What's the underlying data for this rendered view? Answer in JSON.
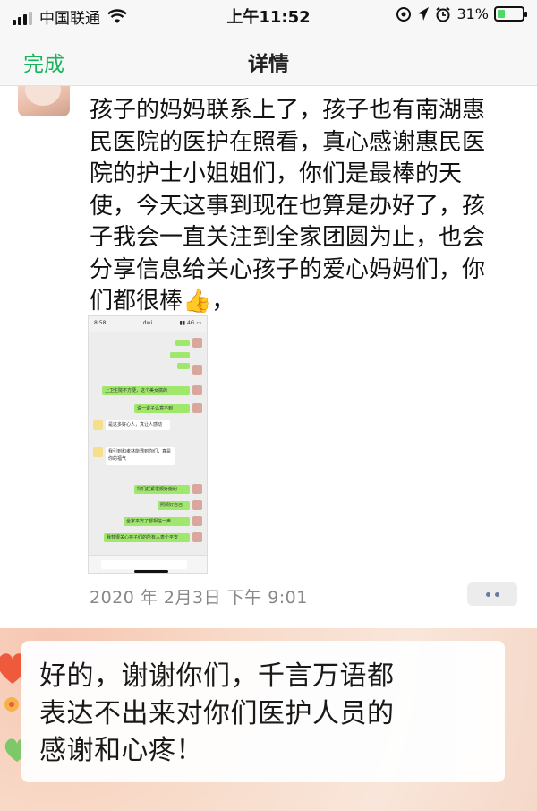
{
  "status_bar": {
    "carrier": "中国联通",
    "time": "上午11:52",
    "battery": "31%",
    "battery_level": 0.31
  },
  "nav": {
    "done_label": "完成",
    "title": "详情"
  },
  "message": {
    "text": "孩子的妈妈联系上了，孩子也有南湖惠\n民医院的医护在照看，真心感谢惠民医\n院的护士小姐姐们，你们是最棒的天\n使，今天这事到现在也算是办好了，孩\n子我会一直关注到全家团圆为止，也会\n分享信息给关心孩子的爱心妈妈们，你\n们都很棒",
    "trailing_punct": "，",
    "emoji": "👍",
    "timestamp": "2020 年 2月3日  下午 9:01"
  },
  "embedded_screenshot": {
    "time": "8:58",
    "name": "dwi",
    "status": "▮▮ 4G ▭",
    "right_bubbles": [
      "上卫生院不方便，这个美女搞的",
      "说一说子么意不到",
      "你们赶紧很顺好搬的",
      "照顾好自己",
      "全家平安了都相信一声",
      "我替很关心孩子们的所有人表个平安"
    ],
    "left_bubbles": [
      "是这多好心人，真让人感动",
      "我引到和孝林能遇到你们，真是你的福气"
    ]
  },
  "reply": {
    "text": "好的，谢谢你们，千言万语都\n表达不出来对你们医护人员的\n感谢和心疼！"
  }
}
